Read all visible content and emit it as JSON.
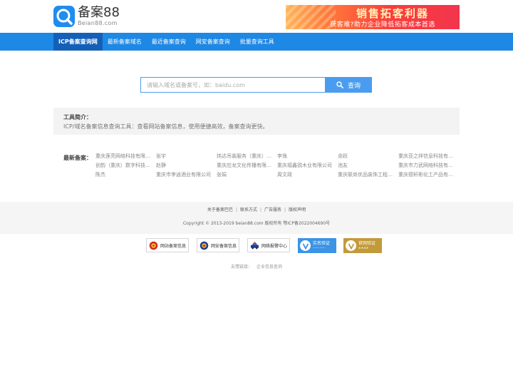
{
  "header": {
    "logo_name": "备案88",
    "logo_domain": "Beian88.com",
    "ad_title": "销售拓客利器",
    "ad_subtitle": "获客难?助力企业降低拓客成本首选"
  },
  "nav": {
    "items": [
      {
        "label": "ICP备案查询网",
        "active": true
      },
      {
        "label": "最新备案域名",
        "active": false
      },
      {
        "label": "最近备案查询",
        "active": false
      },
      {
        "label": "网安备案查询",
        "active": false
      },
      {
        "label": "批量查询工具",
        "active": false
      }
    ]
  },
  "search": {
    "placeholder": "请输入域名或备案号，如：baidu.com",
    "value": "",
    "button_label": "查询"
  },
  "intro": {
    "title": "工具简介：",
    "text": "ICP/域名备案信息查询工具：查看网站备案信息，使用便捷高效，备案查询更快。"
  },
  "latest": {
    "label": "最新备案：",
    "items": [
      "重庆莲亮网络科技有限公司",
      "张宇",
      "炜达吊装服务（重庆）有限公司",
      "李逸",
      "余跃",
      "重庆亚之祥信息科技有限公司",
      "创韵（重庆）数字科技有限公司",
      "赵静",
      "重庆应龙文化传播有限公司",
      "重庆福鑫锐木业有限公司",
      "池友",
      "重庆市力武网络科技有限公司",
      "陈杰",
      "重庆市李逍酒业有限公司",
      "张娟",
      "周文政",
      "重庆联尚优品装饰工程有限公司",
      "重庆德轩彬化工产品有限公司"
    ]
  },
  "footer": {
    "links": [
      "关于备案巴巴",
      "联系方式",
      "广告服务",
      "版权声明"
    ],
    "copyright": "Copyright © 2013-2019 beian88.com 版权所有 鄂ICP备2022004690号"
  },
  "badges": [
    {
      "label": "网站备案信息",
      "icon": "national-emblem-icon"
    },
    {
      "label": "网安备案信息",
      "icon": "police-emblem-icon"
    },
    {
      "label": "网络报警中心",
      "icon": "police-car-icon"
    },
    {
      "label": "实名验证",
      "small": "——·——",
      "icon": "v-check-icon",
      "color": "#3d93e6"
    },
    {
      "label": "官网验证",
      "small": "★★★★",
      "icon": "v-check-icon",
      "color": "#c39a3a"
    }
  ],
  "friend_links": {
    "label": "友情链接：",
    "items": [
      "企业信息查询"
    ]
  },
  "colors": {
    "nav_bg": "#1e88e5",
    "nav_active": "#1460b8",
    "search_accent": "#4a9cf0",
    "brand": "#1f8cf0"
  }
}
